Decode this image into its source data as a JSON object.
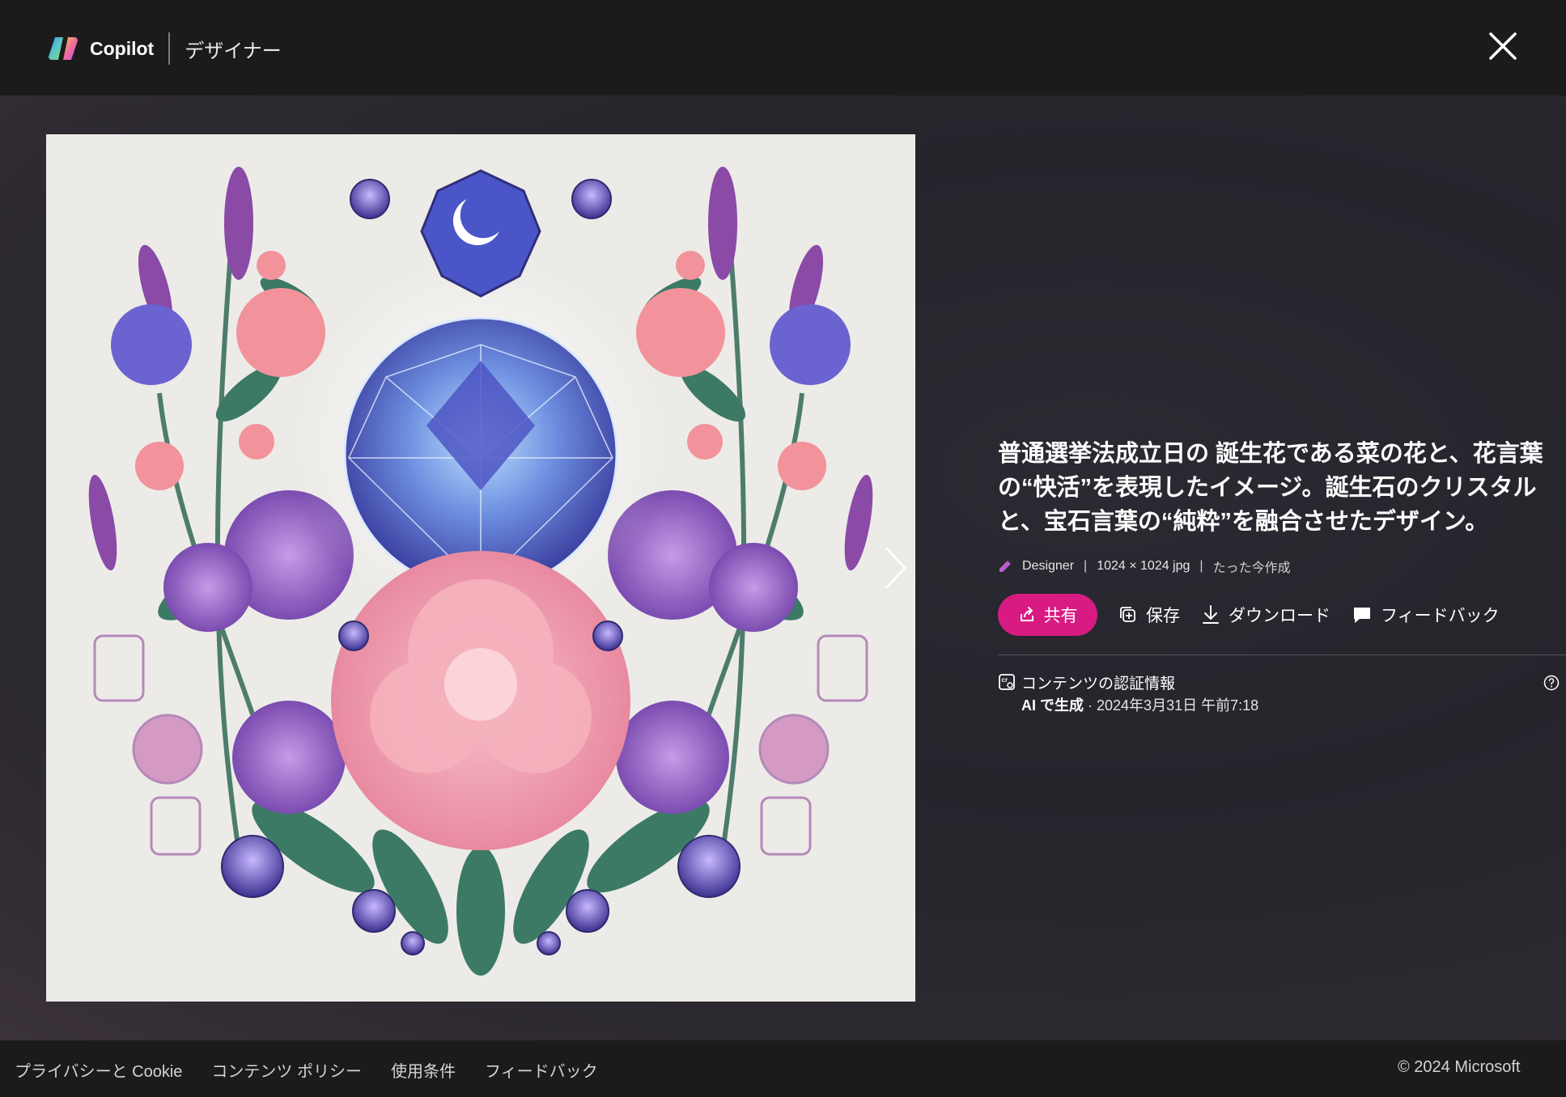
{
  "header": {
    "brand_name": "Copilot",
    "sub_title": "デザイナー"
  },
  "prompt": {
    "text": "普通選挙法成立日の 誕生花である菜の花と、花言葉の“快活”を表現したイメージ。誕生石のクリスタルと、宝石言葉の“純粋”を融合させたデザイン。"
  },
  "meta": {
    "source": "Designer",
    "dimensions": "1024 × 1024 jpg",
    "created": "たった今作成"
  },
  "actions": {
    "share": "共有",
    "save": "保存",
    "download": "ダウンロード",
    "feedback": "フィードバック"
  },
  "credentials": {
    "title": "コンテンツの認証情報",
    "ai_label": "AI で生成",
    "date": " · 2024年3月31日 午前7:18"
  },
  "footer": {
    "links": [
      "プライバシーと Cookie",
      "コンテンツ ポリシー",
      "使用条件",
      "フィードバック"
    ],
    "copyright": "© 2024 Microsoft"
  },
  "colors": {
    "share_button": "#d81b83",
    "header_bg": "#1b1b1b",
    "image_bg": "#edebe8"
  },
  "icons": [
    "copilot-logo",
    "close-icon",
    "chevron-right-icon",
    "designer-icon",
    "share-icon",
    "save-icon",
    "download-icon",
    "feedback-icon",
    "credentials-icon",
    "help-icon"
  ]
}
